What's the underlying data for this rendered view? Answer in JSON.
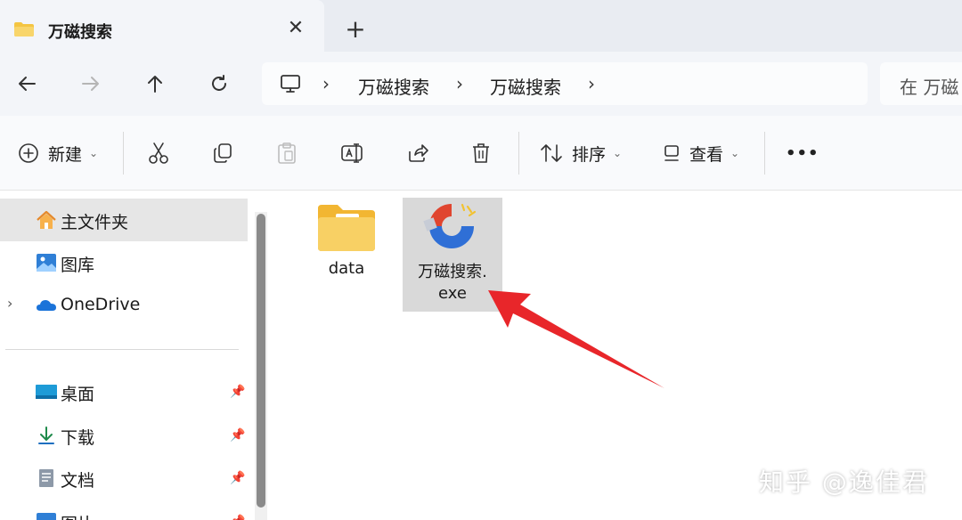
{
  "tab": {
    "title": "万磁搜索",
    "close_glyph": "✕",
    "new_tab_glyph": "+"
  },
  "nav": {
    "back_icon": "arrow-left-icon",
    "forward_icon": "arrow-right-icon",
    "up_icon": "arrow-up-icon",
    "refresh_icon": "refresh-icon"
  },
  "breadcrumb": {
    "separator": "›",
    "items": [
      "万磁搜索",
      "万磁搜索"
    ]
  },
  "search": {
    "placeholder": "在 万磁"
  },
  "toolbar": {
    "new_label": "新建",
    "sort_label": "排序",
    "view_label": "查看",
    "more_label": "•••"
  },
  "sidebar": {
    "items": [
      {
        "label": "主文件夹",
        "icon": "home-icon"
      },
      {
        "label": "图库",
        "icon": "gallery-icon"
      },
      {
        "label": "OneDrive",
        "icon": "onedrive-cloud-icon"
      },
      {
        "label": "桌面",
        "icon": "desktop-icon",
        "pinned": true
      },
      {
        "label": "下载",
        "icon": "download-icon",
        "pinned": true
      },
      {
        "label": "文档",
        "icon": "documents-icon",
        "pinned": true
      },
      {
        "label": "图片",
        "icon": "pictures-icon",
        "pinned": true
      }
    ]
  },
  "files": [
    {
      "name": "data",
      "type": "folder"
    },
    {
      "name": "万磁搜索.exe",
      "name_line1": "万磁搜索.",
      "name_line2": "exe",
      "type": "application",
      "selected": true
    }
  ],
  "watermark": "知乎 @逸佳君",
  "colors": {
    "accent": "#0067c0",
    "arrow": "#e8262a",
    "selection": "#d9d9d9"
  }
}
